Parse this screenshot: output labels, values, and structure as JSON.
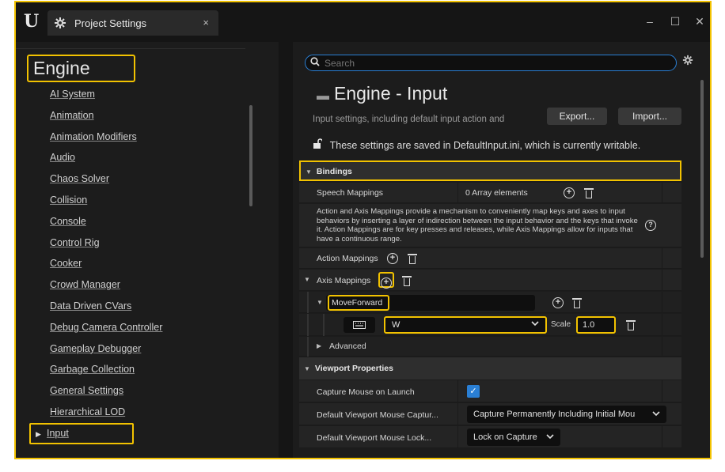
{
  "window": {
    "logo": "U",
    "tab_title": "Project Settings",
    "tab_close": "×",
    "minimize": "–",
    "maximize": "☐",
    "close": "✕"
  },
  "sidebar": {
    "heading": "Engine",
    "items": [
      {
        "label": "AI System"
      },
      {
        "label": "Animation"
      },
      {
        "label": "Animation Modifiers"
      },
      {
        "label": "Audio"
      },
      {
        "label": "Chaos Solver"
      },
      {
        "label": "Collision"
      },
      {
        "label": "Console"
      },
      {
        "label": "Control Rig"
      },
      {
        "label": "Cooker"
      },
      {
        "label": "Crowd Manager"
      },
      {
        "label": "Data Driven CVars"
      },
      {
        "label": "Debug Camera Controller"
      },
      {
        "label": "Gameplay Debugger"
      },
      {
        "label": "Garbage Collection"
      },
      {
        "label": "General Settings"
      },
      {
        "label": "Hierarchical LOD"
      },
      {
        "label": "Input"
      }
    ],
    "active_arrow": "▶"
  },
  "main": {
    "search_placeholder": "Search",
    "title": "Engine - Input",
    "description": "Input settings, including default input action and",
    "export_label": "Export...",
    "import_label": "Import...",
    "writable_notice": "These settings are saved in DefaultInput.ini, which is currently writable.",
    "bindings": {
      "header": "Bindings",
      "speech_mappings_label": "Speech Mappings",
      "speech_mappings_value": "0 Array elements",
      "help_text": "Action and Axis Mappings provide a mechanism to conveniently map keys and axes to input behaviors by inserting a layer of indirection between the input behavior and the keys that invoke it. Action Mappings are for key presses and releases, while Axis Mappings allow for inputs that have a continuous range.",
      "action_mappings_label": "Action Mappings",
      "axis_mappings_label": "Axis Mappings",
      "axis_name": "MoveForward",
      "key_value": "W",
      "scale_label": "Scale",
      "scale_value": "1.0",
      "advanced_label": "Advanced"
    },
    "viewport": {
      "header": "Viewport Properties",
      "capture_mouse_label": "Capture Mouse on Launch",
      "capture_mouse_checked": true,
      "default_capture_label": "Default Viewport Mouse Captur...",
      "default_capture_value": "Capture Permanently Including Initial Mou",
      "default_lock_label": "Default Viewport Mouse Lock...",
      "default_lock_value": "Lock on Capture"
    }
  },
  "colors": {
    "highlight": "#f2c200",
    "accent": "#2a7fd4",
    "bg": "#1c1c1c"
  }
}
